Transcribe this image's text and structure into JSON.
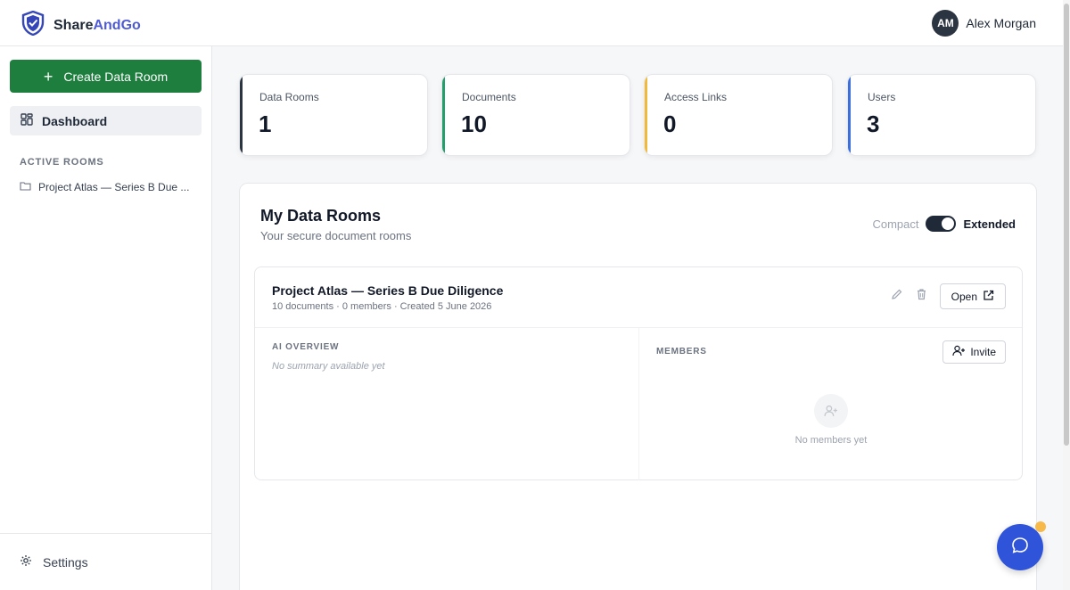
{
  "header": {
    "brand_part1": "Share",
    "brand_part2": "AndGo",
    "user_initials": "AM",
    "user_name": "Alex Morgan"
  },
  "sidebar": {
    "create_label": "Create Data Room",
    "dashboard_label": "Dashboard",
    "section_label": "ACTIVE ROOMS",
    "rooms": [
      {
        "label": "Project Atlas — Series B Due ..."
      }
    ],
    "settings_label": "Settings"
  },
  "stats": [
    {
      "label": "Data Rooms",
      "value": "1",
      "color": "#2b3441"
    },
    {
      "label": "Documents",
      "value": "10",
      "color": "#22a06b"
    },
    {
      "label": "Access Links",
      "value": "0",
      "color": "#f0b93b"
    },
    {
      "label": "Users",
      "value": "3",
      "color": "#3b6fe0"
    }
  ],
  "main": {
    "title": "My Data Rooms",
    "subtitle": "Your secure document rooms",
    "toggle_off_label": "Compact",
    "toggle_on_label": "Extended",
    "room": {
      "title": "Project Atlas — Series B Due Diligence",
      "meta": "10 documents · 0 members · Created 5 June 2026",
      "open_label": "Open",
      "ai_label": "AI OVERVIEW",
      "ai_text": "No summary available yet",
      "members_label": "MEMBERS",
      "invite_label": "Invite",
      "empty_members": "No members yet"
    }
  },
  "colors": {
    "brand_accent": "#4f5bd5",
    "primary_green": "#1e7e3e",
    "chat_blue": "#2f54d9"
  }
}
